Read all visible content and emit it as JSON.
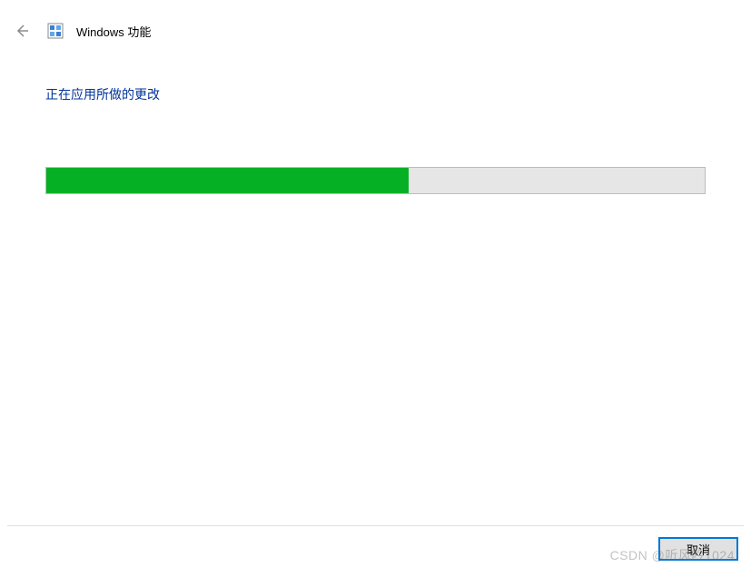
{
  "header": {
    "title": "Windows 功能"
  },
  "content": {
    "heading": "正在应用所做的更改",
    "progress_percent": 55
  },
  "footer": {
    "cancel_label": "取消"
  },
  "watermark": "CSDN @听风吟1024"
}
